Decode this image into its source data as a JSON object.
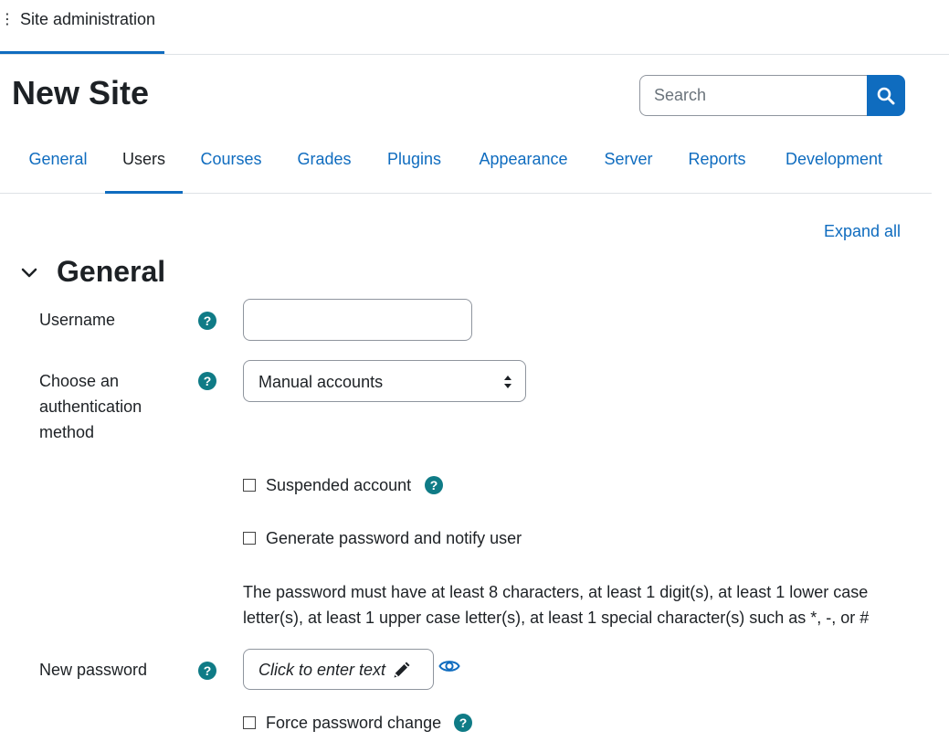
{
  "header": {
    "breadcrumb": "Site administration",
    "page_title": "New Site"
  },
  "search": {
    "placeholder": "Search",
    "icon": "search-icon"
  },
  "tabs": [
    {
      "label": "General"
    },
    {
      "label": "Users"
    },
    {
      "label": "Courses"
    },
    {
      "label": "Grades"
    },
    {
      "label": "Plugins"
    },
    {
      "label": "Appearance"
    },
    {
      "label": "Server"
    },
    {
      "label": "Reports"
    },
    {
      "label": "Development"
    }
  ],
  "active_tab": "Users",
  "expand_all": "Expand all",
  "section": {
    "title": "General",
    "icon": "chevron-down-icon"
  },
  "form": {
    "username_label": "Username",
    "username_value": "",
    "auth_label": "Choose an authentication method",
    "auth_value": "Manual accounts",
    "suspended_label": "Suspended account",
    "generate_password_label": "Generate password and notify user",
    "password_policy": "The password must have at least 8 characters, at least 1 digit(s), at least 1 lower case letter(s), at least 1 upper case letter(s), at least 1 special character(s) such as *, -, or #",
    "new_password_label": "New password",
    "new_password_placeholder": "Click to enter text",
    "force_change_label": "Force password change"
  },
  "colors": {
    "primary": "#0f6cbf",
    "help": "#0f7b86",
    "text": "#1d2125"
  }
}
